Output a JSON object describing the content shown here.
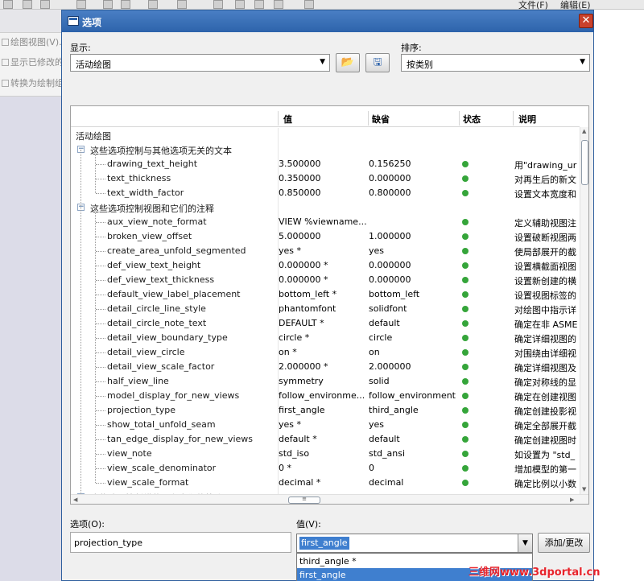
{
  "background": {
    "menu_file": "文件(F)",
    "menu_edit": "编辑(E)",
    "left_items": [
      "绘图视图(V)...",
      "显示已修改的",
      "转换为绘制组"
    ]
  },
  "dialog": {
    "title": "选项",
    "close_label": "✕",
    "show_label": "显示:",
    "show_value": "活动绘图",
    "sort_label": "排序:",
    "sort_value": "按类别",
    "columns": {
      "name": "",
      "value": "值",
      "default": "缺省",
      "status": "状态",
      "desc": "说明"
    },
    "root": "活动绘图",
    "group1": "这些选项控制与其他选项无关的文本",
    "group2": "这些选项控制视图和它们的注释",
    "group3_partial": "这些选项控制横截面和它们的箭头",
    "group1_rows": [
      {
        "name": "drawing_text_height",
        "value": "3.500000",
        "default": "0.156250",
        "desc": "用\"drawing_ur"
      },
      {
        "name": "text_thickness",
        "value": "0.350000",
        "default": "0.000000",
        "desc": "对再生后的新文"
      },
      {
        "name": "text_width_factor",
        "value": "0.850000",
        "default": "0.800000",
        "desc": "设置文本宽度和"
      }
    ],
    "group2_rows": [
      {
        "name": "aux_view_note_format",
        "value": "VIEW %viewname...",
        "default": "",
        "desc": "定义辅助视图注"
      },
      {
        "name": "broken_view_offset",
        "value": "5.000000",
        "default": "1.000000",
        "desc": "设置破断视图两"
      },
      {
        "name": "create_area_unfold_segmented",
        "value": "yes *",
        "default": "yes",
        "desc": "使局部展开的截"
      },
      {
        "name": "def_view_text_height",
        "value": "0.000000 *",
        "default": "0.000000",
        "desc": "设置横截面视图"
      },
      {
        "name": "def_view_text_thickness",
        "value": "0.000000 *",
        "default": "0.000000",
        "desc": "设置新创建的横"
      },
      {
        "name": "default_view_label_placement",
        "value": "bottom_left *",
        "default": "bottom_left",
        "desc": "设置视图标签的"
      },
      {
        "name": "detail_circle_line_style",
        "value": "phantomfont",
        "default": "solidfont",
        "desc": "对绘图中指示详"
      },
      {
        "name": "detail_circle_note_text",
        "value": "DEFAULT *",
        "default": "default",
        "desc": "确定在非 ASME"
      },
      {
        "name": "detail_view_boundary_type",
        "value": "circle *",
        "default": "circle",
        "desc": "确定详细视图的"
      },
      {
        "name": "detail_view_circle",
        "value": "on *",
        "default": "on",
        "desc": "对围绕由详细视"
      },
      {
        "name": "detail_view_scale_factor",
        "value": "2.000000 *",
        "default": "2.000000",
        "desc": "确定详细视图及"
      },
      {
        "name": "half_view_line",
        "value": "symmetry",
        "default": "solid",
        "desc": "确定对称线的显"
      },
      {
        "name": "model_display_for_new_views",
        "value": "follow_environme...",
        "default": "follow_environment",
        "desc": "确定在创建视图"
      },
      {
        "name": "projection_type",
        "value": "first_angle",
        "default": "third_angle",
        "desc": "确定创建投影视"
      },
      {
        "name": "show_total_unfold_seam",
        "value": "yes *",
        "default": "yes",
        "desc": "确定全部展开截"
      },
      {
        "name": "tan_edge_display_for_new_views",
        "value": "default *",
        "default": "default",
        "desc": "确定创建视图时"
      },
      {
        "name": "view_note",
        "value": "std_iso",
        "default": "std_ansi",
        "desc": "如设置为 \"std_"
      },
      {
        "name": "view_scale_denominator",
        "value": "0 *",
        "default": "0",
        "desc": "增加模型的第一"
      },
      {
        "name": "view_scale_format",
        "value": "decimal *",
        "default": "decimal",
        "desc": "确定比例以小数"
      }
    ],
    "option_label": "选项(O):",
    "option_value": "projection_type",
    "value_label": "值(V):",
    "value_current": "first_angle",
    "add_change_label": "添加/更改",
    "dropdown_options": [
      "third_angle *",
      "first_angle"
    ],
    "status_color": "#35a53a",
    "accent_color": "#3f7fcf"
  },
  "watermark": "三维网www.3dportal.cn"
}
